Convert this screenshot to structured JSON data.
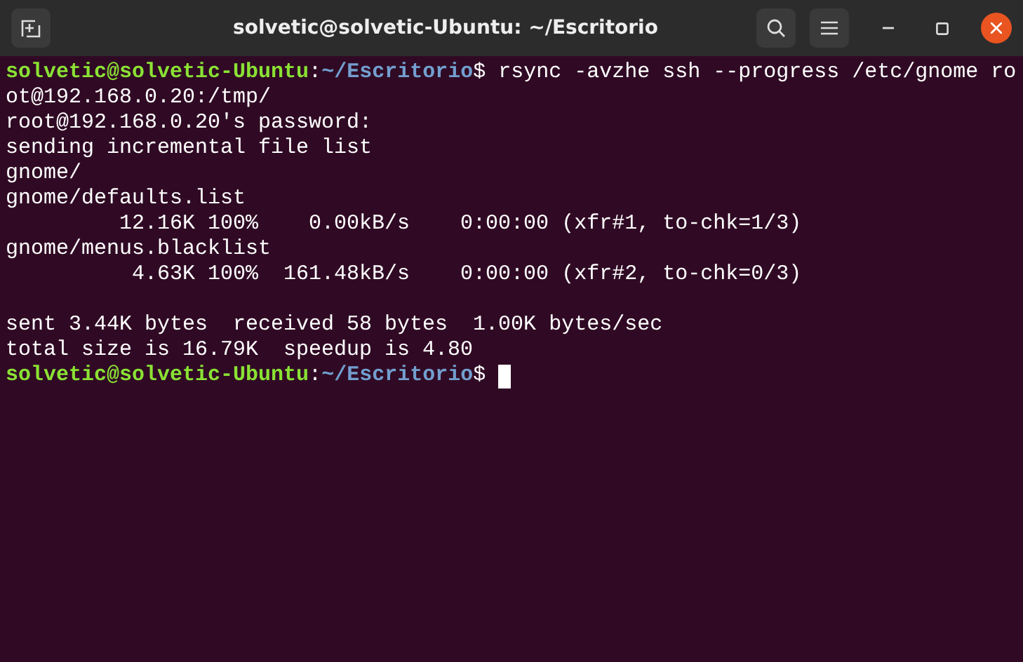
{
  "window": {
    "title": "solvetic@solvetic-Ubuntu: ~/Escritorio"
  },
  "lines": [
    {
      "kind": "prompt",
      "user_host": "solvetic@solvetic-Ubuntu",
      "separator": ":",
      "path": "~/Escritorio",
      "symbol": "$",
      "command": " rsync -avzhe ssh --progress /etc/gnome ro"
    },
    {
      "kind": "output",
      "text": "ot@192.168.0.20:/tmp/"
    },
    {
      "kind": "output",
      "text": "root@192.168.0.20's password:"
    },
    {
      "kind": "output",
      "text": "sending incremental file list"
    },
    {
      "kind": "output",
      "text": "gnome/"
    },
    {
      "kind": "output",
      "text": "gnome/defaults.list"
    },
    {
      "kind": "output",
      "text": "         12.16K 100%    0.00kB/s    0:00:00 (xfr#1, to-chk=1/3)"
    },
    {
      "kind": "output",
      "text": "gnome/menus.blacklist"
    },
    {
      "kind": "output",
      "text": "          4.63K 100%  161.48kB/s    0:00:00 (xfr#2, to-chk=0/3)"
    },
    {
      "kind": "blank"
    },
    {
      "kind": "output",
      "text": "sent 3.44K bytes  received 58 bytes  1.00K bytes/sec"
    },
    {
      "kind": "output",
      "text": "total size is 16.79K  speedup is 4.80"
    },
    {
      "kind": "prompt",
      "user_host": "solvetic@solvetic-Ubuntu",
      "separator": ":",
      "path": "~/Escritorio",
      "symbol": "$",
      "cursor": true
    }
  ]
}
